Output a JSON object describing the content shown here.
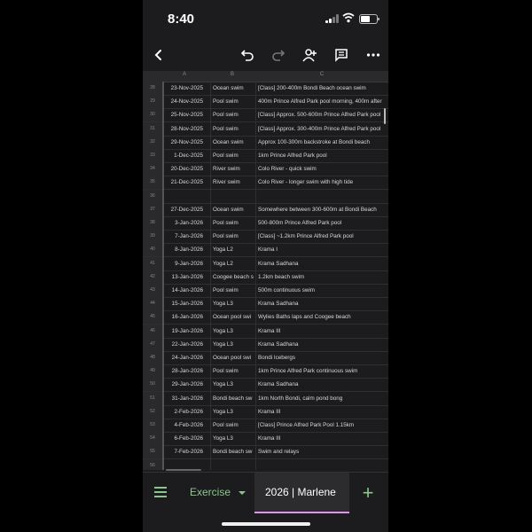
{
  "status_bar": {
    "time": "8:40"
  },
  "toolbar": {
    "back_icon": "chevron-left-icon",
    "undo_icon": "undo-icon",
    "redo_icon": "redo-icon",
    "share_icon": "add-person-icon",
    "comment_icon": "comment-icon",
    "more_icon": "more-horizontal-icon"
  },
  "sheet": {
    "columns": [
      "A",
      "B",
      "C"
    ],
    "rows": [
      {
        "n": "28",
        "date": "23-Nov-2025",
        "type": "Ocean swim",
        "desc": "[Class] 200-400m Bondi Beach ocean swim"
      },
      {
        "n": "29",
        "date": "24-Nov-2025",
        "type": "Pool swim",
        "desc": "400m Prince Alfred Park pool morning, 400m after"
      },
      {
        "n": "30",
        "date": "25-Nov-2025",
        "type": "Pool swim",
        "desc": "[Class] Approx. 500-600m Prince Alfred Park pool"
      },
      {
        "n": "31",
        "date": "28-Nov-2025",
        "type": "Pool swim",
        "desc": "[Class] Approx. 300-400m Prince Alfred Park pool"
      },
      {
        "n": "32",
        "date": "29-Nov-2025",
        "type": "Ocean swim",
        "desc": "Approx 100-300m backstroke at Bondi beach"
      },
      {
        "n": "33",
        "date": "1-Dec-2025",
        "type": "Pool swim",
        "desc": "1km Prince Alfred Park pool"
      },
      {
        "n": "34",
        "date": "20-Dec-2025",
        "type": "River swim",
        "desc": "Colo River - quick swim"
      },
      {
        "n": "35",
        "date": "21-Dec-2025",
        "type": "River swim",
        "desc": "Colo River - longer swim with high tide"
      },
      {
        "n": "36",
        "date": "",
        "type": "",
        "desc": ""
      },
      {
        "n": "37",
        "date": "27-Dec-2025",
        "type": "Ocean swim",
        "desc": "Somewhere between 300-600m at Bondi Beach"
      },
      {
        "n": "38",
        "date": "3-Jan-2026",
        "type": "Pool swim",
        "desc": "500-800m Prince Alfred Park pool"
      },
      {
        "n": "39",
        "date": "7-Jan-2026",
        "type": "Pool swim",
        "desc": "[Class] ~1.2km Prince Alfred Park pool"
      },
      {
        "n": "40",
        "date": "8-Jan-2026",
        "type": "Yoga L2",
        "desc": "Krama I"
      },
      {
        "n": "41",
        "date": "9-Jan-2026",
        "type": "Yoga L2",
        "desc": "Krama Sadhana"
      },
      {
        "n": "42",
        "date": "13-Jan-2026",
        "type": "Coogee beach s",
        "desc": "1.2km beach swim"
      },
      {
        "n": "43",
        "date": "14-Jan-2026",
        "type": "Pool swim",
        "desc": "500m continuous swim"
      },
      {
        "n": "44",
        "date": "15-Jan-2026",
        "type": "Yoga L3",
        "desc": "Krama Sadhana"
      },
      {
        "n": "45",
        "date": "16-Jan-2026",
        "type": "Ocean pool swi",
        "desc": "Wylies Baths laps and Coogee beach"
      },
      {
        "n": "46",
        "date": "19-Jan-2026",
        "type": "Yoga L3",
        "desc": "Krama III"
      },
      {
        "n": "47",
        "date": "22-Jan-2026",
        "type": "Yoga L3",
        "desc": "Krama Sadhana"
      },
      {
        "n": "48",
        "date": "24-Jan-2026",
        "type": "Ocean pool swi",
        "desc": "Bondi Icebergs"
      },
      {
        "n": "49",
        "date": "28-Jan-2026",
        "type": "Pool swim",
        "desc": "1km Prince Alfred Park continuous swim"
      },
      {
        "n": "50",
        "date": "29-Jan-2026",
        "type": "Yoga L3",
        "desc": "Krama Sadhana"
      },
      {
        "n": "51",
        "date": "31-Jan-2026",
        "type": "Bondi beach sw",
        "desc": "1km North Bondi, calm pond bong"
      },
      {
        "n": "52",
        "date": "2-Feb-2026",
        "type": "Yoga L3",
        "desc": "Krama III"
      },
      {
        "n": "53",
        "date": "4-Feb-2026",
        "type": "Pool swim",
        "desc": "[Class] Prince Alfred Park Pool 1.15km"
      },
      {
        "n": "54",
        "date": "6-Feb-2026",
        "type": "Yoga L3",
        "desc": "Krama III"
      },
      {
        "n": "55",
        "date": "7-Feb-2026",
        "type": "Bondi beach sw",
        "desc": "Swim and relays"
      },
      {
        "n": "56",
        "date": "",
        "type": "",
        "desc": ""
      }
    ]
  },
  "bottom": {
    "menu_icon": "menu-icon",
    "tab_exercise": "Exercise",
    "tab_dropdown_icon": "caret-down-icon",
    "tab_active": "2026 | Marlene",
    "add_sheet": "+",
    "accent": "#8bc78b",
    "active_underline": "#e48ff0"
  }
}
